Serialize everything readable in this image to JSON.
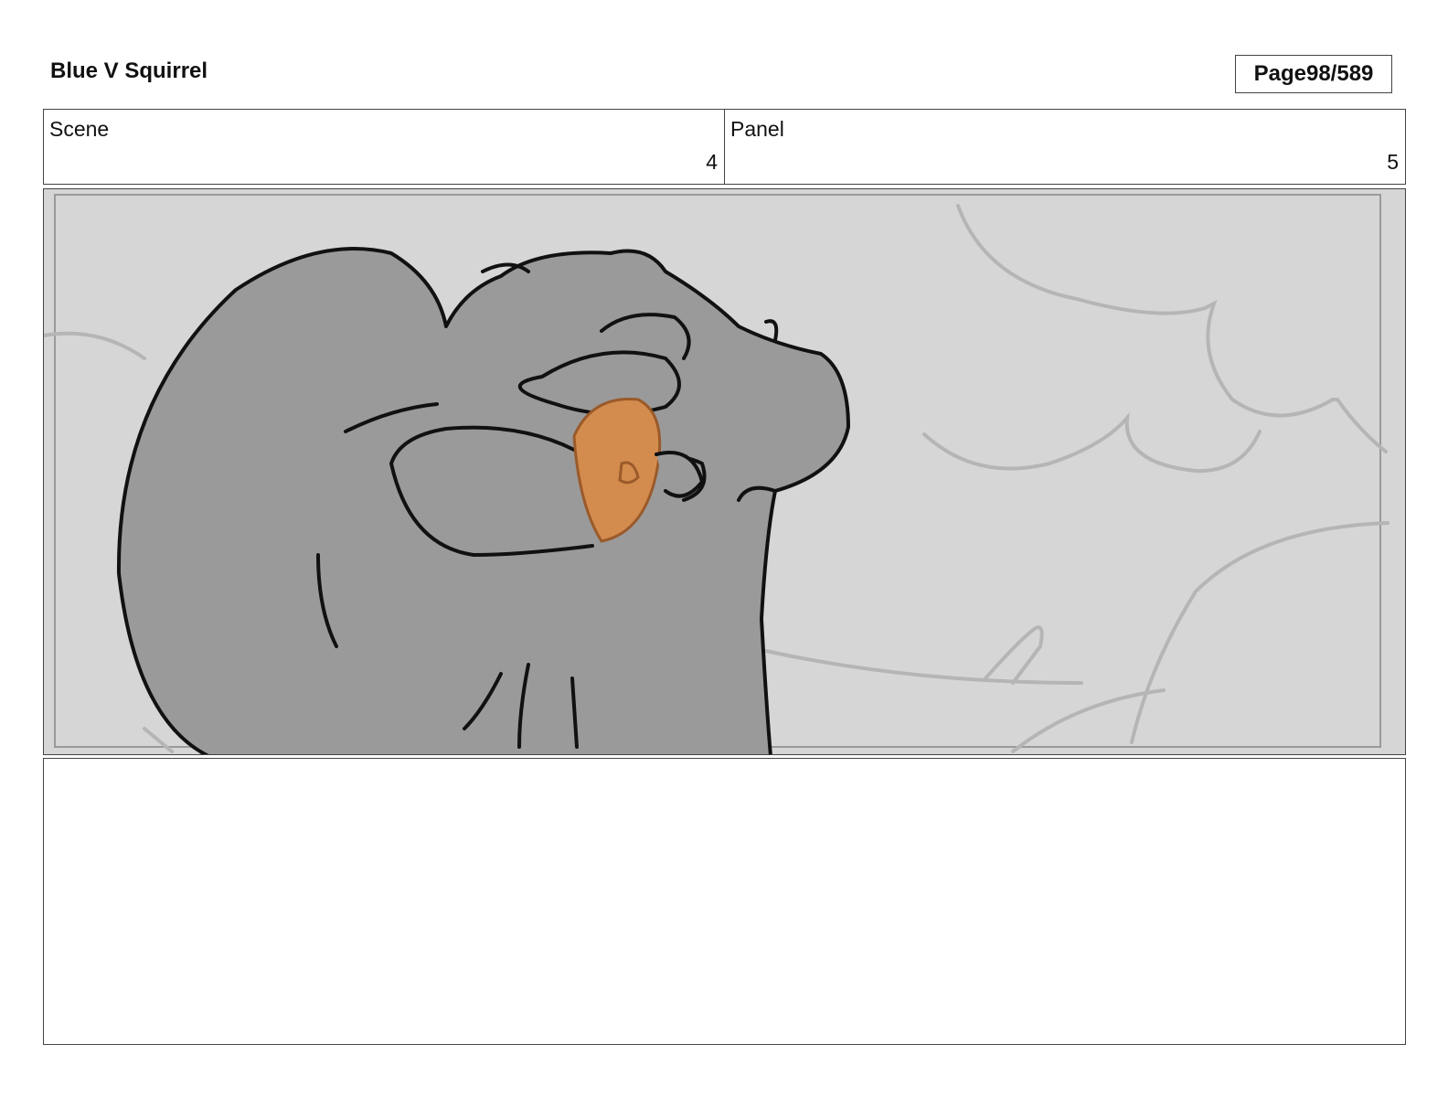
{
  "header": {
    "title": "Blue V Squirrel",
    "page_label": "Page",
    "page_number": "98/589"
  },
  "scene": {
    "label": "Scene",
    "value": "4"
  },
  "panel": {
    "label": "Panel",
    "value": "5"
  },
  "colors": {
    "sky": "#d6d6d6",
    "cloud_line": "#b5b5b5",
    "squirrel_body": "#9a9a9a",
    "outline": "#111111",
    "acorn": "#d48c4e",
    "acorn_line": "#9a5a2a"
  }
}
